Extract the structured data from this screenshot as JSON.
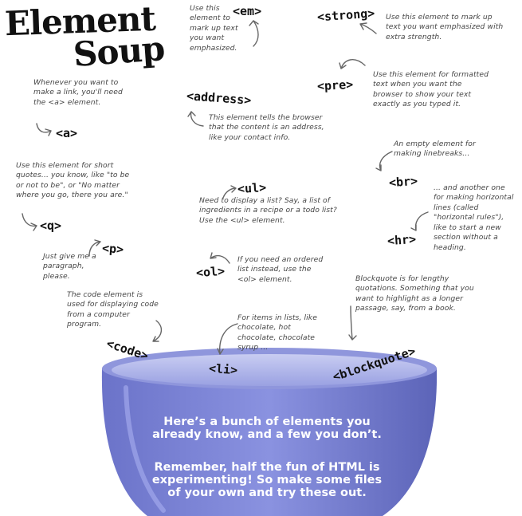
{
  "title": {
    "line1": "Element",
    "line2": "Soup"
  },
  "tags": {
    "em": "<em>",
    "strong": "<strong>",
    "pre": "<pre>",
    "address": "<address>",
    "a": "<a>",
    "q": "<q>",
    "p": "<p>",
    "ul": "<ul>",
    "ol": "<ol>",
    "br": "<br>",
    "hr": "<hr>",
    "code": "<code>",
    "li": "<li>",
    "blockquote": "<blockquote>"
  },
  "notes": {
    "em": "Use this element to mark up text you want emphasized.",
    "strong": "Use this element to mark up text you want emphasized with extra strength.",
    "pre": "Use this element for formatted text when you want the browser to show your text exactly as you typed it.",
    "address": "This element tells the browser that the content is an address, like your contact info.",
    "a": "Whenever you want to make a link, you'll need the <a> element.",
    "q": "Use this element for short quotes... you know, like \"to be or not to be\", or \"No matter where you go, there you are.\"",
    "p": "Just give me a paragraph, please.",
    "ul": "Need to display a list? Say, a list of ingredients in a recipe or a todo list? Use the <ul> element.",
    "ol": "If you need an ordered list instead, use the <ol> element.",
    "br": "An empty element for making linebreaks...",
    "hr": "... and another one for making horizontal lines (called \"horizontal rules\"), like to start a new section without a heading.",
    "code": "The code element is used for displaying code from a computer program.",
    "li": "For items in lists, like chocolate, hot chocolate, chocolate syrup ...",
    "blockquote": "Blockquote is for lengthy quotations. Something that you want to highlight as a longer passage, say, from a book."
  },
  "bowl": {
    "line1": "Here’s a bunch of elements you already know, and a few you don’t.",
    "line2": "Remember, half the fun of HTML is experimenting! So make some files of your own and try these out.",
    "color": "#7a83d6",
    "rim_color": "#aab0e8"
  }
}
